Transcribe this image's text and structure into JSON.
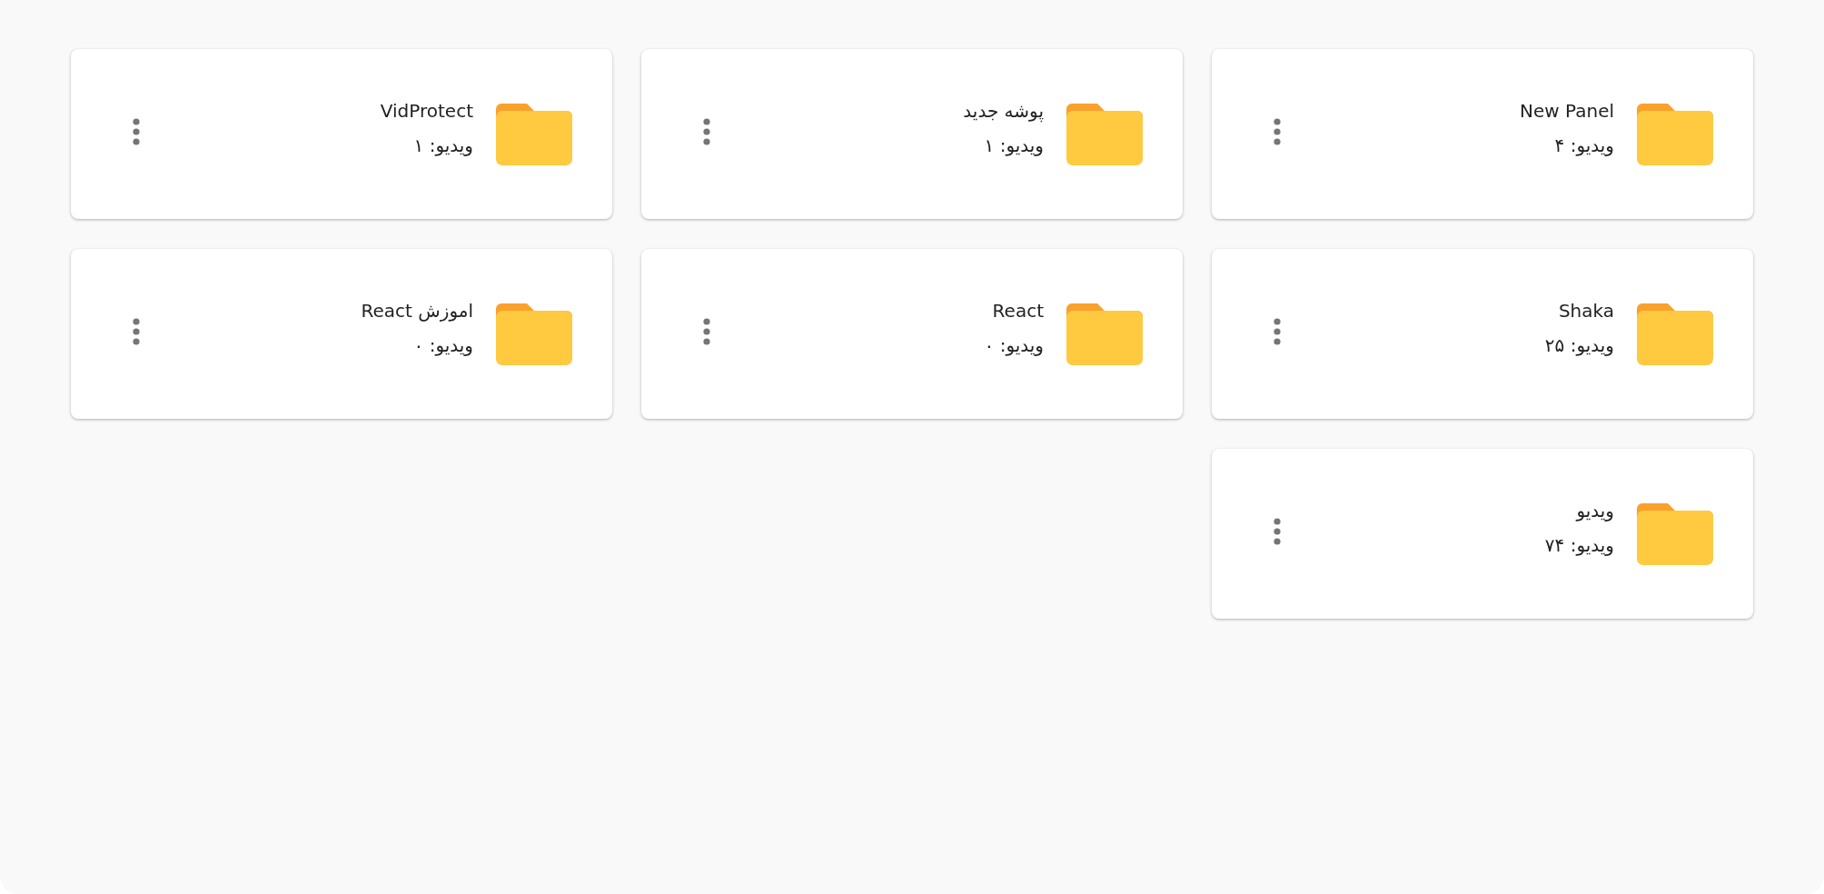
{
  "folders": [
    {
      "name": "New Panel",
      "count": "ویدیو: ۴"
    },
    {
      "name": "پوشه جدید",
      "count": "ویدیو: ۱"
    },
    {
      "name": "VidProtect",
      "count": "ویدیو: ۱"
    },
    {
      "name": "Shaka",
      "count": "ویدیو: ۲۵"
    },
    {
      "name": "React",
      "count": "ویدیو: ۰"
    },
    {
      "name": "اموزش React",
      "count": "ویدیو: ۰"
    },
    {
      "name": "ویدیو",
      "count": "ویدیو: ۷۴"
    }
  ]
}
